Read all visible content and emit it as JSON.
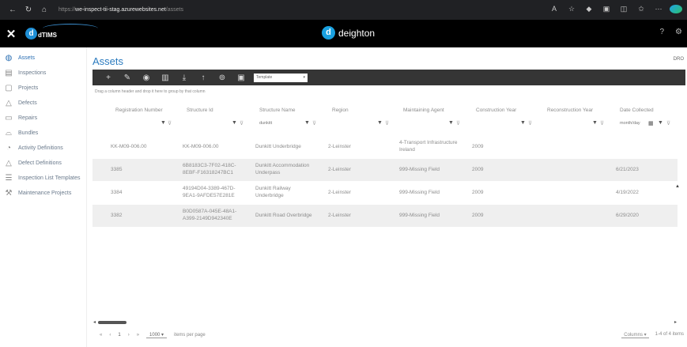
{
  "browser": {
    "url_prefix": "https://",
    "url_host": "we-inspect-tii-stag.azurewebsites.net",
    "url_path": "/assets"
  },
  "app": {
    "product_logo": "dTIMS",
    "brand_name": "deighton"
  },
  "sidebar": {
    "items": [
      {
        "label": "Assets",
        "icon": "globe-icon"
      },
      {
        "label": "Inspections",
        "icon": "clipboard-icon"
      },
      {
        "label": "Projects",
        "icon": "projects-icon"
      },
      {
        "label": "Defects",
        "icon": "warning-icon"
      },
      {
        "label": "Repairs",
        "icon": "repair-icon"
      },
      {
        "label": "Bundles",
        "icon": "bundle-icon"
      },
      {
        "label": "Activity Definitions",
        "icon": "activity-icon"
      },
      {
        "label": "Defect Definitions",
        "icon": "defect-def-icon"
      },
      {
        "label": "Inspection List Templates",
        "icon": "template-icon"
      },
      {
        "label": "Maintenance Projects",
        "icon": "wrench-icon"
      }
    ]
  },
  "page": {
    "title": "Assets",
    "user_code": "DRO",
    "template_select": "Template",
    "drag_hint": "Drag a column header and drop it here to group by that column"
  },
  "grid": {
    "columns": [
      "Registration Number",
      "Structure Id",
      "Structure Name",
      "Region",
      "Maintaining Agent",
      "Construction Year",
      "Reconstruction Year",
      "Date Collected"
    ],
    "filters": {
      "structure_name": "dunkitt",
      "date_collected": "month/day"
    },
    "rows": [
      [
        "KK-M09-006.00",
        "KK-M09-006.00",
        "Dunkitt Underbridge",
        "2-Leinster",
        "4-Transport Infrastructure Ireland",
        "2009",
        "",
        ""
      ],
      [
        "3385",
        "6B8183C3-7F02-418C-8EBF-F16318247BC1",
        "Dunkitt Accommodation Underpass",
        "2-Leinster",
        "999-Missing Field",
        "2009",
        "",
        "6/21/2023"
      ],
      [
        "3384",
        "49194D04-3389-467D-9EA1-9AFDE57E281E",
        "Dunkitt Railway Underbridge",
        "2-Leinster",
        "999-Missing Field",
        "2009",
        "",
        "4/19/2022"
      ],
      [
        "3382",
        "B0D0587A-045E-48A1-A399-2149D942340E",
        "Dunkitt Road Overbridge",
        "2-Leinster",
        "999-Missing Field",
        "2009",
        "",
        "6/29/2020"
      ]
    ]
  },
  "pager": {
    "current_page": "1",
    "page_size": "1000",
    "per_page_label": "items per page",
    "columns_button": "Columns",
    "summary": "1-4 of 4 items"
  }
}
